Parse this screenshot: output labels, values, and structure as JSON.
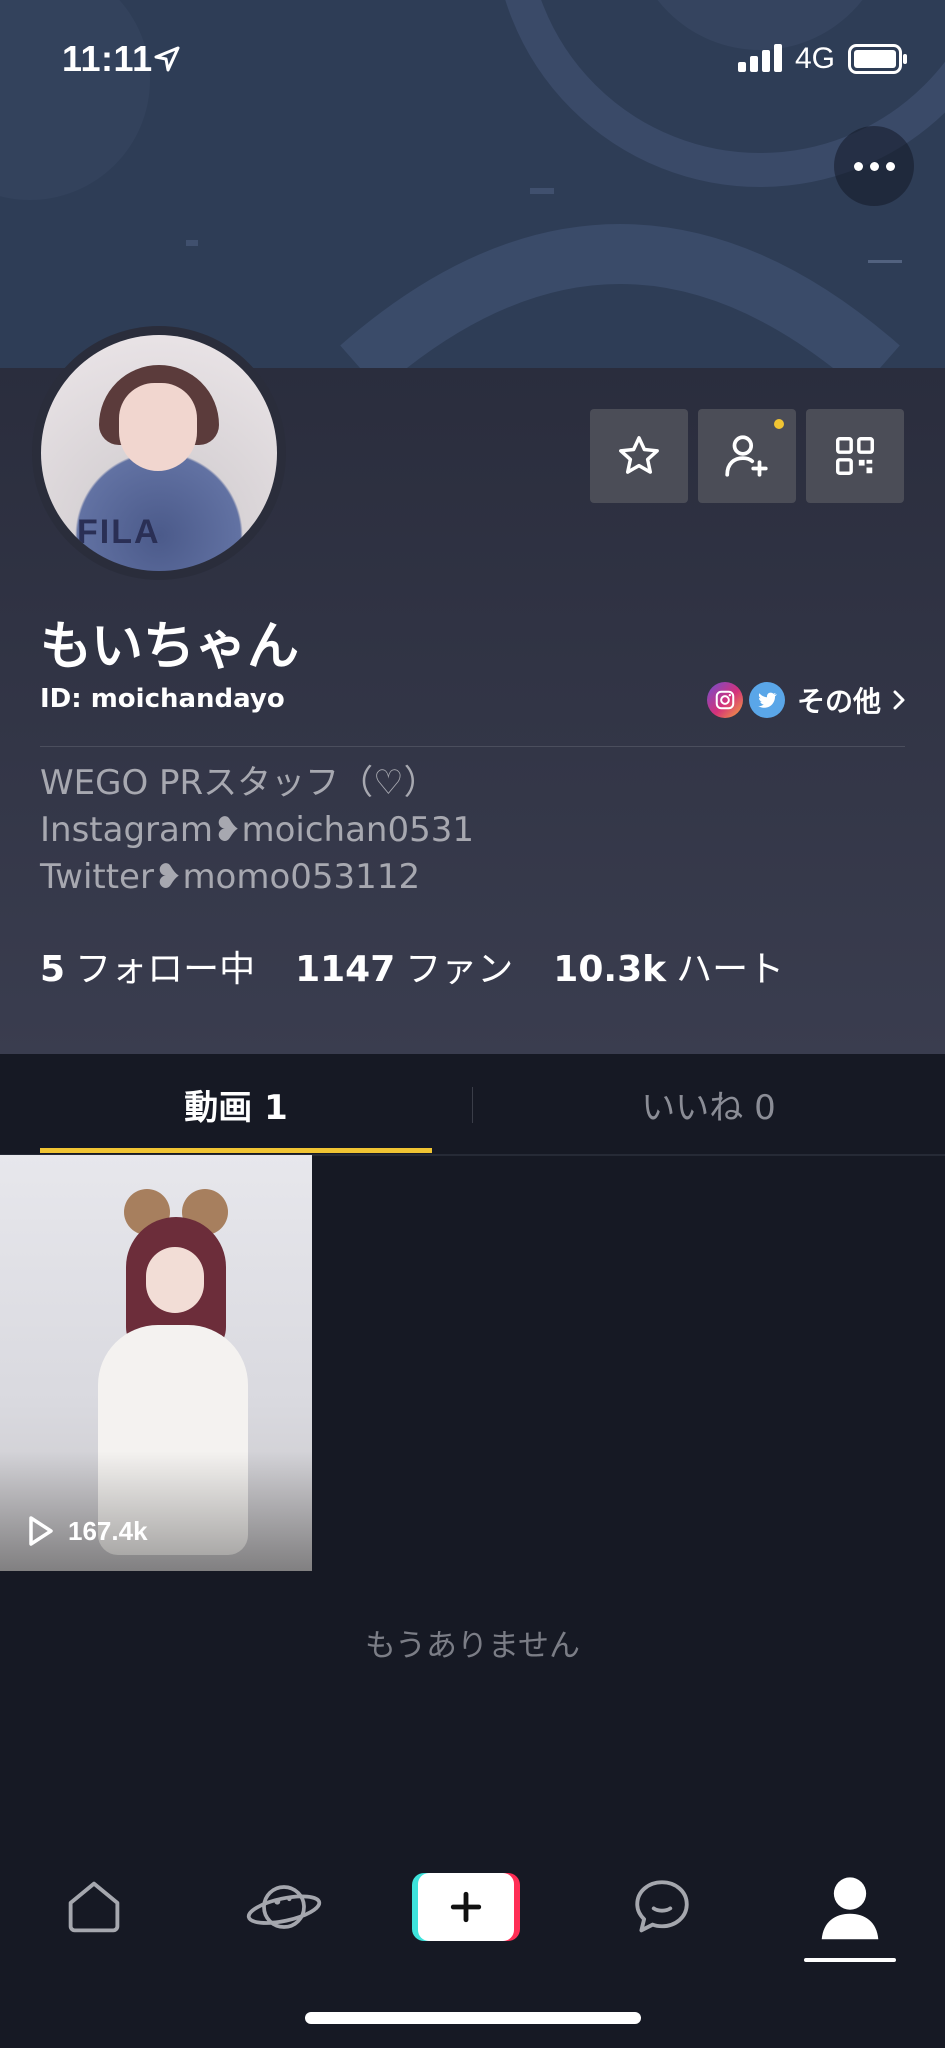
{
  "status_bar": {
    "time": "11:11",
    "network": "4G"
  },
  "profile": {
    "display_name": "もいちゃん",
    "user_id": "ID: moichandayo",
    "social_other_label": "その他",
    "bio_lines": [
      "WEGO PRスタッフ（♡）",
      "Instagram❥moichan0531",
      "Twitter❥momo053112"
    ],
    "stats": {
      "following_count": "5",
      "following_label": "フォロー中",
      "fans_count": "1147",
      "fans_label": "ファン",
      "hearts_count": "10.3k",
      "hearts_label": "ハート"
    }
  },
  "tabs": {
    "videos_label": "動画 1",
    "likes_label": "いいね 0"
  },
  "videos": [
    {
      "play_count": "167.4k"
    }
  ],
  "empty_message": "もうありません",
  "icons": {
    "more": "more-horizontal-icon",
    "favorite": "star-icon",
    "add_friend": "add-user-icon",
    "qr_code": "qr-code-icon",
    "instagram": "instagram-icon",
    "twitter": "twitter-icon",
    "home": "home-icon",
    "discover": "planet-icon",
    "create": "plus-icon",
    "inbox": "message-icon",
    "me": "profile-icon"
  },
  "colors": {
    "accent_yellow": "#f0c433",
    "background": "#161924",
    "banner": "#2e3d56",
    "create_cyan": "#3ee3dc",
    "create_red": "#ff2d55"
  }
}
